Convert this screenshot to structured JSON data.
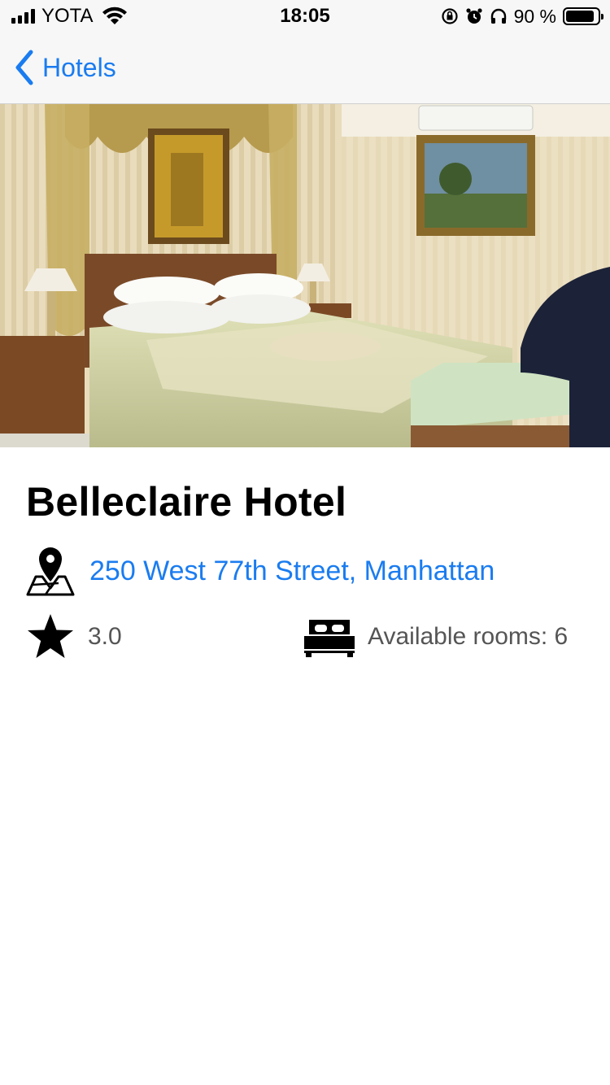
{
  "status_bar": {
    "carrier": "YOTA",
    "time": "18:05",
    "battery_percent": "90 %",
    "battery_level": 0.9
  },
  "nav": {
    "back_label": "Hotels",
    "back_icon": "chevron-left-icon"
  },
  "hotel": {
    "name": "Belleclaire Hotel",
    "address": "250 West 77th Street, Manhattan",
    "rating": "3.0",
    "rooms": "Available rooms: 6"
  },
  "colors": {
    "accent": "#1a7cf0",
    "secondary_text": "#555555",
    "bar_background": "#f7f7f7"
  },
  "icons": {
    "address": "map-pin-icon",
    "rating": "star-icon",
    "rooms": "bed-icon"
  }
}
